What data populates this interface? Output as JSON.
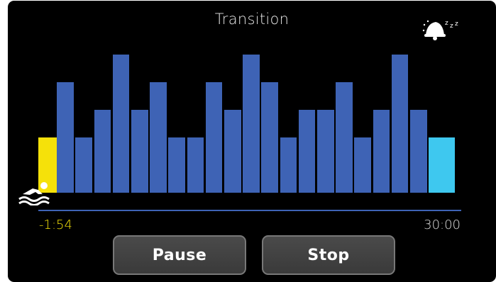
{
  "screen": {
    "title": "Transition",
    "icons": {
      "sleep": "sleep-bell-zzz-icon",
      "swimmer": "swimmer-icon"
    }
  },
  "timeline": {
    "elapsed": "-1:54",
    "total": "30:00",
    "colors": {
      "current": "#f5e10a",
      "future": "#3e63b5",
      "end": "#3ec8ef",
      "line": "#3e63b5"
    }
  },
  "intensity_bars": {
    "levels": [
      2,
      4,
      2,
      3,
      5,
      3,
      4,
      2,
      2,
      4,
      3,
      5,
      4,
      2,
      3,
      3,
      4,
      2,
      3,
      5,
      3,
      2
    ],
    "current_index": 0,
    "end_index": 21
  },
  "buttons": {
    "pause": "Pause",
    "stop": "Stop"
  }
}
